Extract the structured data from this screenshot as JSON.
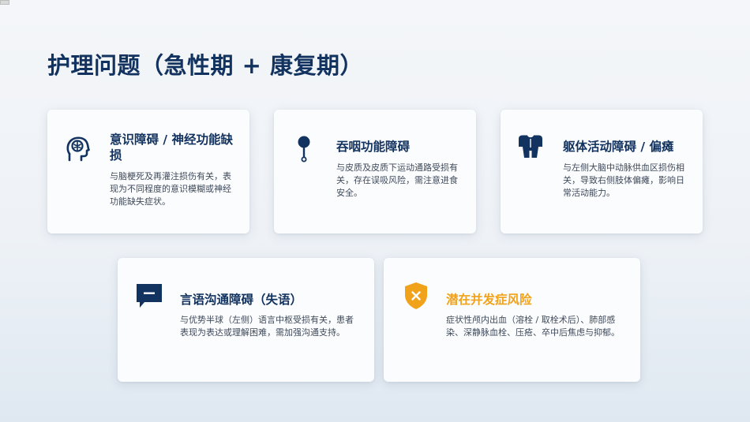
{
  "page": {
    "title": "护理问题（急性期 + 康复期）"
  },
  "colors": {
    "primary": "#12335f",
    "accent": "#f0a21a",
    "text": "#3f4a5a"
  },
  "cards": [
    {
      "icon": "head-brain-icon",
      "title": "意识障碍 / 神经功能缺损",
      "description": "与脑梗死及再灌注损伤有关，表现为不同程度的意识模糊或神经功能缺失症状。"
    },
    {
      "icon": "throat-pin-icon",
      "title": "吞咽功能障碍",
      "description": "与皮质及皮质下运动通路受损有关，存在误吸风险，需注意进食安全。"
    },
    {
      "icon": "torso-body-icon",
      "title": "躯体活动障碍 / 偏瘫",
      "description": "与左侧大脑中动脉供血区损伤相关，导致右侧肢体偏瘫，影响日常活动能力。"
    },
    {
      "icon": "speech-bubble-icon",
      "title": "言语沟通障碍（失语）",
      "description": "与优势半球（左侧）语言中枢受损有关，患者表现为表达或理解困难，需加强沟通支持。"
    },
    {
      "icon": "shield-warning-icon",
      "title": "潜在并发症风险",
      "description": "症状性颅内出血（溶栓 / 取栓术后）、肺部感染、深静脉血栓、压疮、卒中后焦虑与抑郁。"
    }
  ]
}
